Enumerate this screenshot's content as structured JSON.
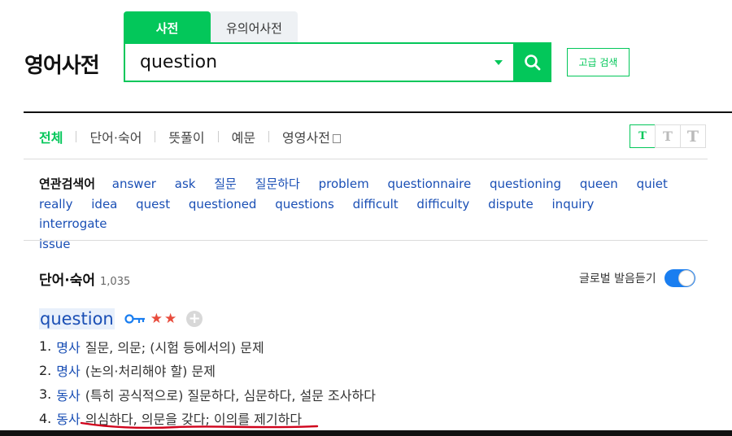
{
  "logo": "영어사전",
  "dict_tabs": [
    "사전",
    "유의어사전"
  ],
  "search": {
    "value": "question",
    "advanced_label": "고급 검색"
  },
  "menu": {
    "items": [
      "전체",
      "단어·숙어",
      "뜻풀이",
      "예문",
      "영영사전"
    ]
  },
  "font_size_buttons": [
    "T",
    "T",
    "T"
  ],
  "related": {
    "title": "연관검색어",
    "terms": [
      "answer",
      "ask",
      "질문",
      "질문하다",
      "problem",
      "questionnaire",
      "questioning",
      "queen",
      "quiet",
      "really",
      "idea",
      "quest",
      "questioned",
      "questions",
      "difficult",
      "difficulty",
      "dispute",
      "inquiry",
      "interrogate",
      "issue"
    ]
  },
  "section": {
    "title": "단어·숙어",
    "count": "1,035"
  },
  "global_pronunciation": {
    "label": "글로벌 발음듣기",
    "enabled": true
  },
  "entry": {
    "headword": "question",
    "stars": "★★",
    "senses": [
      {
        "num": "1.",
        "pos": "명사",
        "def": "질문, 의문; (시험 등에서의) 문제"
      },
      {
        "num": "2.",
        "pos": "명사",
        "def": "(논의·처리해야 할) 문제"
      },
      {
        "num": "3.",
        "pos": "동사",
        "def": "(특히 공식적으로) 질문하다, 심문하다, 설문 조사하다"
      },
      {
        "num": "4.",
        "pos": "동사",
        "def": "의심하다, 의문을 갖다; 이의를 제기하다"
      }
    ]
  },
  "colors": {
    "accent": "#03c75a",
    "link": "#1a4fb5",
    "stars": "#e84c3d",
    "toggle": "#1a7ef0",
    "annotation": "#d0021b"
  },
  "icons": [
    "search-icon",
    "chevron-down-icon",
    "external-window-icon",
    "key-icon",
    "star-icon",
    "plus-icon"
  ]
}
